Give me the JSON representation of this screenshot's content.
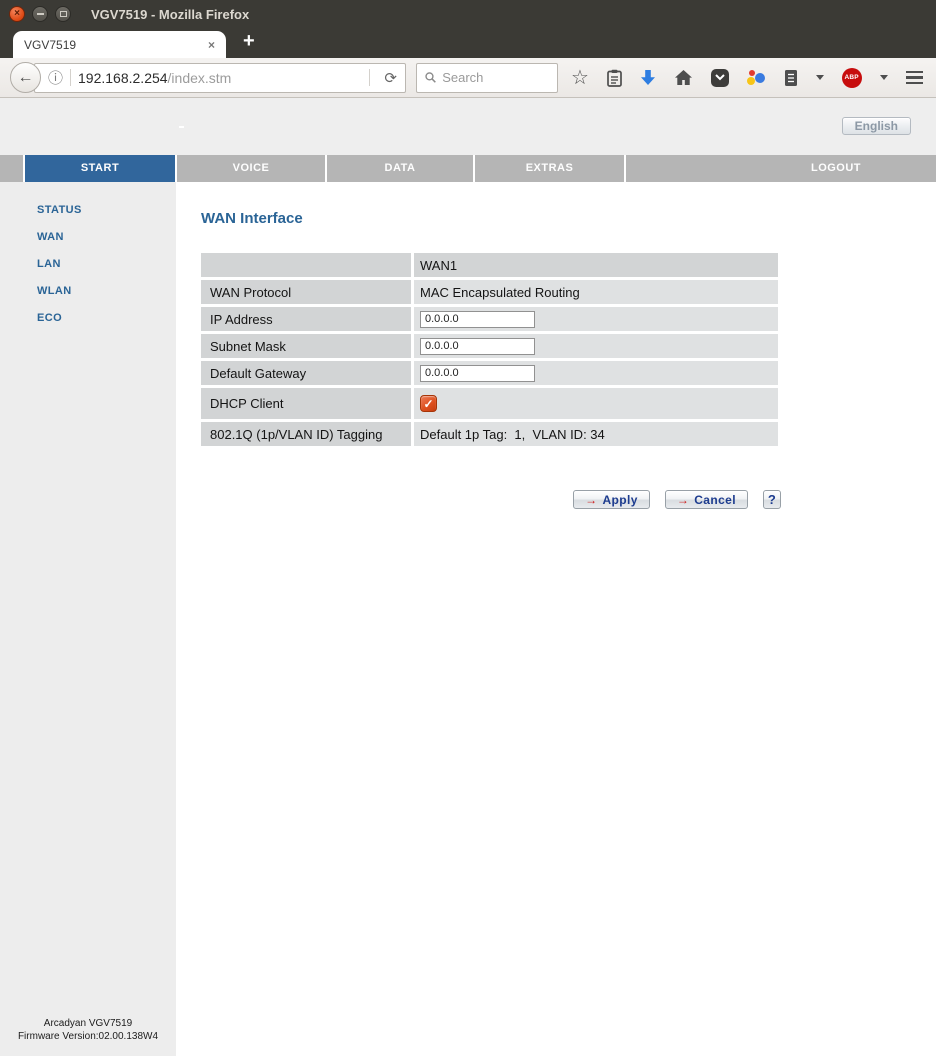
{
  "window": {
    "title": "VGV7519 - Mozilla Firefox"
  },
  "browser": {
    "tab_title": "VGV7519",
    "url_domain": "192.168.2.254",
    "url_path": "/index.stm",
    "search_placeholder": "Search",
    "abp_label": "ABP"
  },
  "icons": {
    "window_close": "×",
    "tab_close": "×",
    "new_tab": "+",
    "back": "←",
    "info": "ⓘ",
    "reload": "⟳",
    "search": "magnifier",
    "bookmark_star": "☆",
    "bookmarks_menu": "clipboard",
    "downloads": "blue-down-arrow",
    "home": "house",
    "pocket": "pocket-chevron",
    "addon_dots": "three-colored-dots",
    "addon_notes": "notebook",
    "dropdown_chevron": "v",
    "menu": "hamburger",
    "apply_arrow": "→",
    "cancel_arrow": "→",
    "dhcp_check": "✓"
  },
  "page": {
    "language_button": "English",
    "nav_tabs": [
      {
        "label": "START",
        "active": true
      },
      {
        "label": "VOICE",
        "active": false
      },
      {
        "label": "DATA",
        "active": false
      },
      {
        "label": "EXTRAS",
        "active": false
      },
      {
        "label": "LOGOUT",
        "active": false
      }
    ],
    "sidebar": {
      "items": [
        {
          "label": "STATUS"
        },
        {
          "label": "WAN"
        },
        {
          "label": "LAN"
        },
        {
          "label": "WLAN"
        },
        {
          "label": "ECO"
        }
      ],
      "footer_line1": "Arcadyan VGV7519",
      "footer_line2": "Firmware Version:02.00.138W4"
    },
    "main": {
      "heading": "WAN Interface",
      "table": {
        "header_value": "WAN1",
        "rows": [
          {
            "label": "WAN Protocol",
            "value": "MAC Encapsulated Routing"
          },
          {
            "label": "IP Address",
            "input_value": "0.0.0.0"
          },
          {
            "label": "Subnet Mask",
            "input_value": "0.0.0.0"
          },
          {
            "label": "Default Gateway",
            "input_value": "0.0.0.0"
          },
          {
            "label": "DHCP Client",
            "checked": true,
            "check_glyph": "✓"
          },
          {
            "label": "802.1Q (1p/VLAN ID) Tagging",
            "value": "Default 1p Tag:  1,  VLAN ID: 34"
          }
        ]
      },
      "apply_label": "Apply",
      "cancel_label": "Cancel",
      "help_label": "?"
    }
  },
  "colors": {
    "titlebar_bg": "#3b3a35",
    "close_button_orange": "#e95420",
    "nav_active_blue": "#31669c",
    "nav_gray": "#b5b5b5",
    "link_blue": "#2a6496",
    "checkbox_orange": "#dd4814",
    "button_text_navy": "#1d3c8f",
    "arrow_red": "#cc1414",
    "abp_red": "#c70d0d",
    "download_blue": "#2e7de1"
  }
}
